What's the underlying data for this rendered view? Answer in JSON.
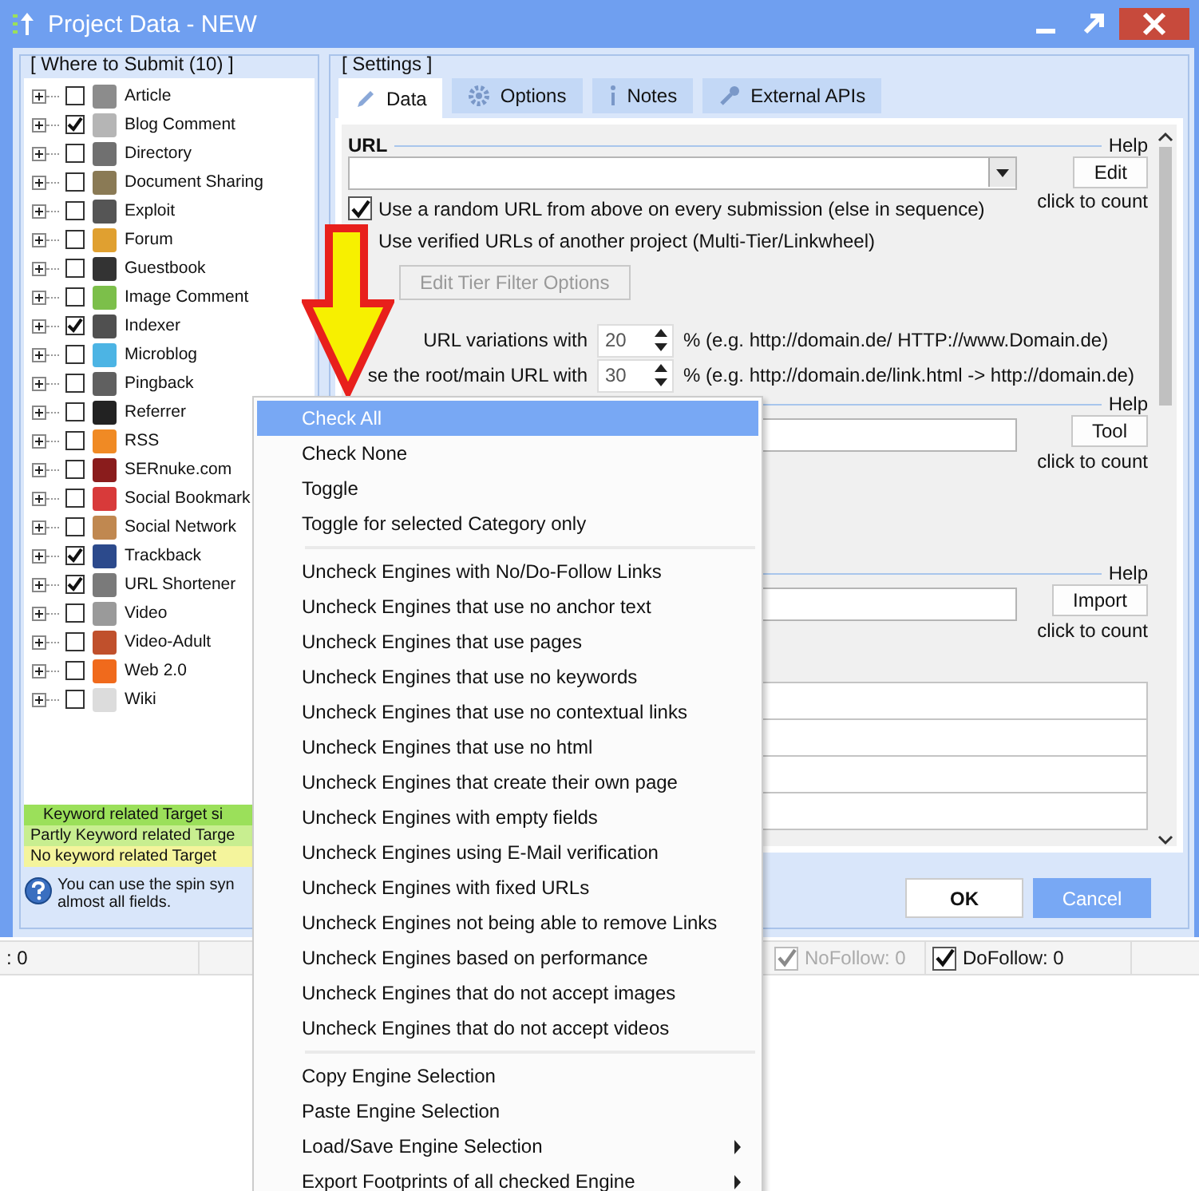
{
  "window": {
    "title": "Project Data - NEW"
  },
  "submit": {
    "title": "[ Where to Submit  (10) ]",
    "items": [
      {
        "label": "Article",
        "checked": false,
        "color": "#8c8c8c"
      },
      {
        "label": "Blog Comment",
        "checked": true,
        "color": "#b5b5b5"
      },
      {
        "label": "Directory",
        "checked": false,
        "color": "#707070"
      },
      {
        "label": "Document Sharing",
        "checked": false,
        "color": "#8a7a55"
      },
      {
        "label": "Exploit",
        "checked": false,
        "color": "#555555"
      },
      {
        "label": "Forum",
        "checked": false,
        "color": "#e0a030"
      },
      {
        "label": "Guestbook",
        "checked": false,
        "color": "#333333"
      },
      {
        "label": "Image Comment",
        "checked": false,
        "color": "#7cbf4a"
      },
      {
        "label": "Indexer",
        "checked": true,
        "color": "#505050"
      },
      {
        "label": "Microblog",
        "checked": false,
        "color": "#4cb4e4"
      },
      {
        "label": "Pingback",
        "checked": false,
        "color": "#606060"
      },
      {
        "label": "Referrer",
        "checked": false,
        "color": "#222222"
      },
      {
        "label": "RSS",
        "checked": false,
        "color": "#f08a24"
      },
      {
        "label": "SERnuke.com",
        "checked": false,
        "color": "#8a1c1c"
      },
      {
        "label": "Social Bookmark",
        "checked": false,
        "color": "#d83a3a"
      },
      {
        "label": "Social Network",
        "checked": false,
        "color": "#c08850"
      },
      {
        "label": "Trackback",
        "checked": true,
        "color": "#2c4a8c"
      },
      {
        "label": "URL Shortener",
        "checked": true,
        "color": "#7a7a7a"
      },
      {
        "label": "Video",
        "checked": false,
        "color": "#9a9a9a"
      },
      {
        "label": "Video-Adult",
        "checked": false,
        "color": "#c0502c"
      },
      {
        "label": "Web 2.0",
        "checked": false,
        "color": "#f06a1c"
      },
      {
        "label": "Wiki",
        "checked": false,
        "color": "#dcdcdc"
      }
    ],
    "legend": [
      {
        "text": "Keyword related Target si",
        "color": "#9be05a"
      },
      {
        "text": "Partly Keyword related Targe",
        "color": "#c8ee90"
      },
      {
        "text": "No keyword related Target",
        "color": "#f4f49c"
      }
    ],
    "hint": [
      "You can use the spin syn",
      "almost all fields."
    ]
  },
  "settings": {
    "title": "[ Settings ]",
    "tabs": [
      {
        "label": "Data",
        "selected": true
      },
      {
        "label": "Options",
        "selected": false
      },
      {
        "label": "Notes",
        "selected": false
      },
      {
        "label": "External APIs",
        "selected": false
      }
    ],
    "url": {
      "label": "URL",
      "help": "Help",
      "button": "Edit",
      "count": "click to count",
      "options": [
        {
          "label": "Use a random URL from above on every submission (else in sequence)",
          "checked": true
        },
        {
          "label": "Use verified URLs of another project (Multi-Tier/Linkwheel)"
        }
      ],
      "tier_button": {
        "label": "Edit Tier Filter Options",
        "disabled": true
      },
      "spins": [
        {
          "label": "URL variations with",
          "value": "20",
          "suffix": "% (e.g. http://domain.de/ HTTP://www.Domain.de)"
        },
        {
          "label": "se the root/main URL with",
          "value": "30",
          "suffix": "% (e.g. http://domain.de/link.html -> http://domain.de)"
        }
      ]
    },
    "keywords": {
      "help": "Help",
      "button": "Tool",
      "count": "click to count"
    },
    "anchors": {
      "help": "Help",
      "button": "Import",
      "count": "click to count"
    }
  },
  "buttons": [
    {
      "label": "OK",
      "kind": "default"
    },
    {
      "label": "Cancel",
      "kind": "primary"
    }
  ],
  "status_bar": [
    {
      "kind": "text",
      "text": ": 0"
    },
    {
      "kind": "check",
      "text": "NoFollow:  0",
      "checked": true,
      "disabled": true
    },
    {
      "kind": "check",
      "text": "DoFollow:  0",
      "checked": true,
      "disabled": false
    }
  ],
  "menu": [
    {
      "kind": "item",
      "label": "Check All",
      "selected": true
    },
    {
      "kind": "item",
      "label": "Check None",
      "selected": false
    },
    {
      "kind": "item",
      "label": "Toggle",
      "selected": false
    },
    {
      "kind": "item",
      "label": "Toggle for selected Category only",
      "selected": false
    },
    {
      "kind": "separator"
    },
    {
      "kind": "item",
      "label": "Uncheck Engines with No/Do-Follow Links",
      "selected": false
    },
    {
      "kind": "item",
      "label": "Uncheck Engines that use no anchor text",
      "selected": false
    },
    {
      "kind": "item",
      "label": "Uncheck Engines that use pages",
      "selected": false
    },
    {
      "kind": "item",
      "label": "Uncheck Engines that use no keywords",
      "selected": false
    },
    {
      "kind": "item",
      "label": "Uncheck Engines that use no contextual links",
      "selected": false
    },
    {
      "kind": "item",
      "label": "Uncheck Engines that use no html",
      "selected": false
    },
    {
      "kind": "item",
      "label": "Uncheck Engines that create their own page",
      "selected": false
    },
    {
      "kind": "item",
      "label": "Uncheck Engines with empty fields",
      "selected": false
    },
    {
      "kind": "item",
      "label": "Uncheck Engines using E-Mail verification",
      "selected": false
    },
    {
      "kind": "item",
      "label": "Uncheck Engines with fixed URLs",
      "selected": false
    },
    {
      "kind": "item",
      "label": "Uncheck Engines not being able to remove Links",
      "selected": false
    },
    {
      "kind": "item",
      "label": "Uncheck Engines based on performance",
      "selected": false
    },
    {
      "kind": "item",
      "label": "Uncheck Engines that do not accept images",
      "selected": false
    },
    {
      "kind": "item",
      "label": "Uncheck Engines that do not accept videos",
      "selected": false
    },
    {
      "kind": "separator"
    },
    {
      "kind": "item",
      "label": "Copy Engine Selection",
      "selected": false
    },
    {
      "kind": "item",
      "label": "Paste Engine Selection",
      "selected": false
    },
    {
      "kind": "submenu",
      "label": "Load/Save Engine Selection",
      "selected": false
    },
    {
      "kind": "submenu",
      "label": "Export Footprints of all checked Engine",
      "selected": false
    }
  ]
}
